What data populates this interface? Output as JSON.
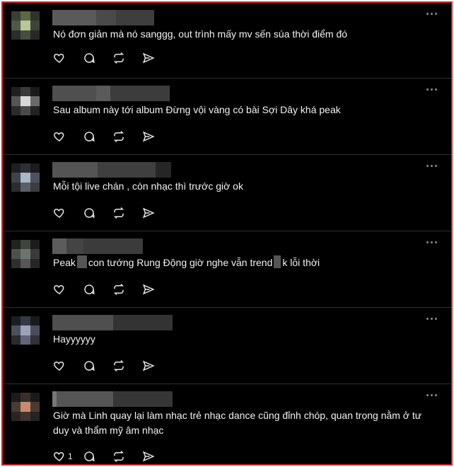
{
  "comments": [
    {
      "text": "Nó đơn giản mà nó sanggg, out trình mấy mv sến súa thời điểm đó",
      "likes": ""
    },
    {
      "text": "Sau album này tới album Đừng vội vàng có bài Sợi Dây khá peak",
      "likes": ""
    },
    {
      "text": "Mỗi tội live chán , còn nhạc thì trước giờ ok",
      "likes": ""
    },
    {
      "text_a": "Peak",
      "text_b": "con tướng Rung Động giờ nghe vẫn trend",
      "text_c": "k lỗi thời",
      "likes": ""
    },
    {
      "text": "Hayyyyyy",
      "likes": ""
    },
    {
      "text": "Giờ mà Linh quay lại làm nhạc trẻ nhạc dance cũng đỉnh chóp, quan trọng nằm ở tư duy và thẩm mỹ âm nhạc",
      "likes": "1"
    }
  ],
  "icons": {
    "like": "heart-icon",
    "reply": "comment-bubble-icon",
    "repost": "repost-icon",
    "share": "send-icon",
    "more": "more-options-icon"
  },
  "colors": {
    "background": "#000000",
    "text": "#f3f3f3",
    "frame": "#d9252a",
    "divider": "#2f2f2f"
  }
}
